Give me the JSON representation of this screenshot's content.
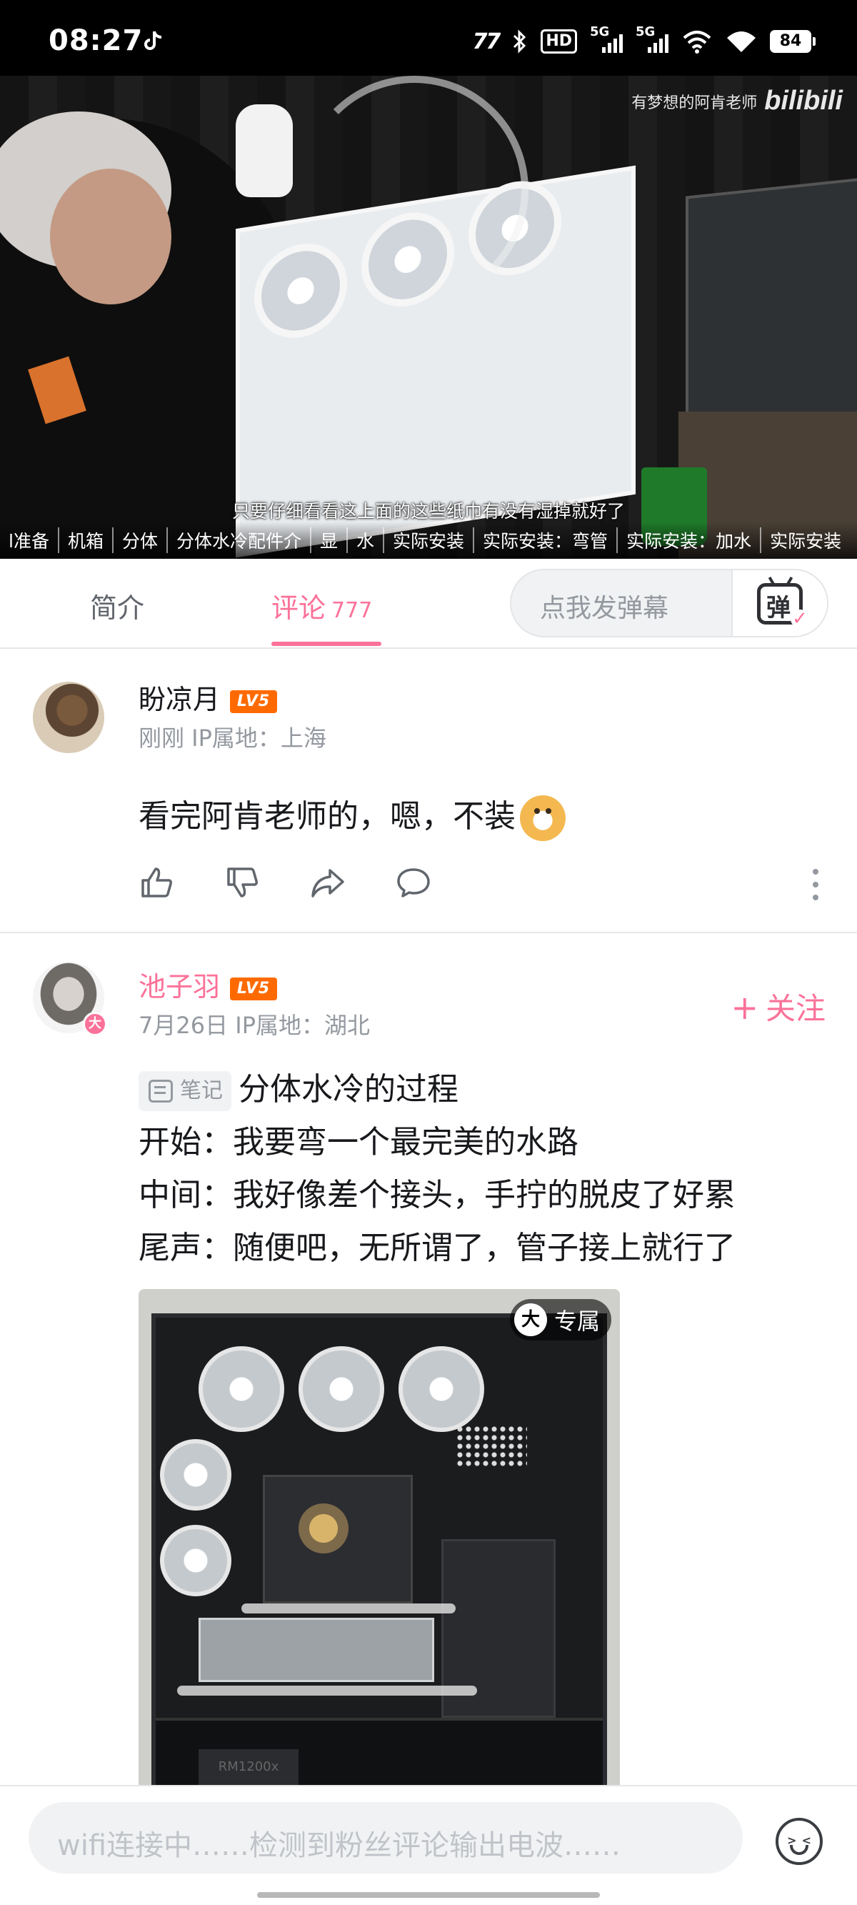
{
  "status_bar": {
    "time": "08:27",
    "carrier": "77",
    "hd_label": "HD",
    "signal1_label": "5G",
    "signal2_label": "5G",
    "battery": "84"
  },
  "video": {
    "watermark_text": "有梦想的阿肯老师",
    "watermark_logo": "bilibili",
    "subtitle": "只要仔细看看这上面的这些纸巾有没有湿掉就好了",
    "chapters": [
      "l准备",
      "机箱",
      "分体",
      "分体水冷配件介",
      "显",
      "水",
      "实际安装",
      "实际安装：弯管",
      "实际安装：加水",
      "实际安装"
    ]
  },
  "tabs": {
    "intro": "简介",
    "comments": "评论",
    "comment_count": "777",
    "danmaku_placeholder": "点我发弹幕",
    "danmaku_icon_char": "弹"
  },
  "comments": [
    {
      "username": "盼凉月",
      "level": "LV5",
      "meta": "刚刚  IP属地：上海",
      "text": "看完阿肯老师的，嗯，不装"
    },
    {
      "username": "池子羽",
      "level": "LV5",
      "meta": "7月26日  IP属地：湖北",
      "follow_label": "关注",
      "vip_char": "大",
      "note_tag": "笔记",
      "lines": [
        "分体水冷的过程",
        "开始：我要弯一个最完美的水路",
        "中间：我好像差个接头，手拧的脱皮了好累",
        "尾声：随便吧，无所谓了，管子接上就行了"
      ],
      "image_badge_char": "大",
      "image_badge": "专属",
      "psu_label": "RM1200x"
    }
  ],
  "reply_input": {
    "placeholder": "wifi连接中……检测到粉丝评论输出电波……"
  },
  "colors": {
    "accent_pink": "#fb7299",
    "level_orange": "#ff6a00",
    "muted_text": "#9499a0"
  }
}
